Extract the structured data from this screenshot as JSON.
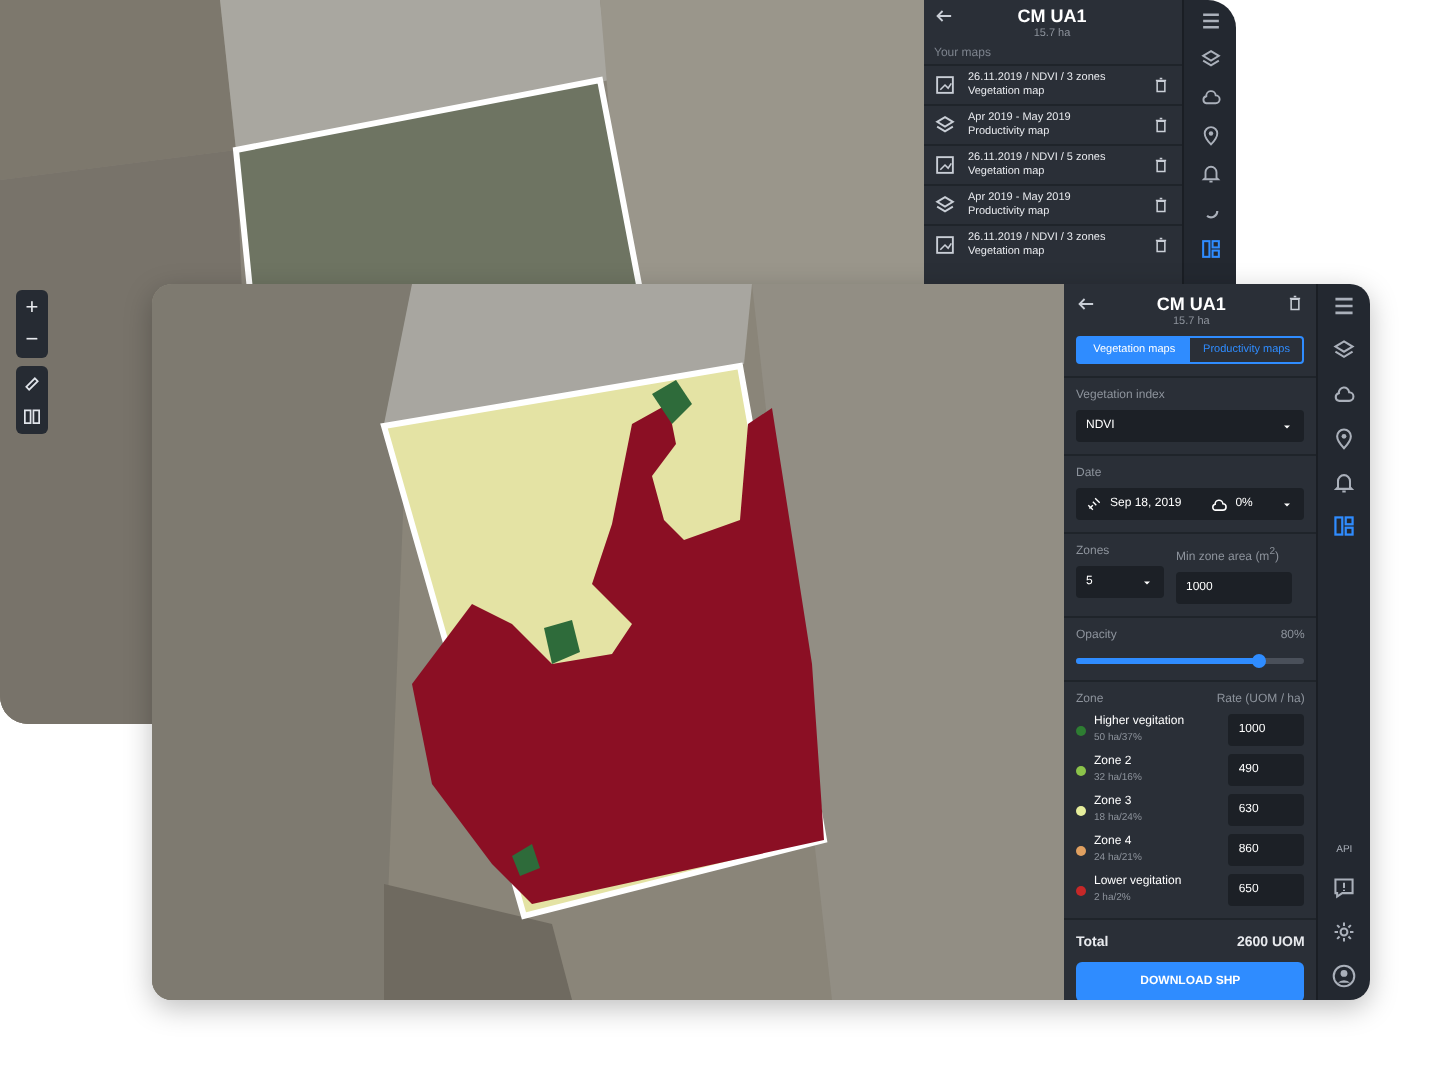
{
  "back_window": {
    "title": "CM UA1",
    "area": "15.7 ha",
    "section_label": "Your maps",
    "maps": [
      {
        "kind": "vegetation",
        "title": "26.11.2019 / NDVI / 3 zones",
        "subtitle": "Vegetation map"
      },
      {
        "kind": "productivity",
        "title": "Apr 2019 - May 2019",
        "subtitle": "Productivity map"
      },
      {
        "kind": "vegetation",
        "title": "26.11.2019 / NDVI / 5 zones",
        "subtitle": "Vegetation map"
      },
      {
        "kind": "productivity",
        "title": "Apr 2019 - May 2019",
        "subtitle": "Productivity map"
      },
      {
        "kind": "vegetation",
        "title": "26.11.2019 / NDVI / 3 zones",
        "subtitle": "Vegetation map"
      }
    ],
    "rail": [
      {
        "kind": "menu",
        "selected": false
      },
      {
        "kind": "layers",
        "selected": false
      },
      {
        "kind": "cloud",
        "selected": false
      },
      {
        "kind": "pin",
        "selected": false
      },
      {
        "kind": "bell",
        "selected": false
      },
      {
        "kind": "spinner",
        "selected": false
      },
      {
        "kind": "grid",
        "selected": true
      }
    ],
    "map_controls": {
      "zoom_in": "+",
      "zoom_out": "−"
    }
  },
  "front_window": {
    "title": "CM UA1",
    "area": "15.7 ha",
    "tabs": [
      {
        "label": "Vegetation maps",
        "selected": true
      },
      {
        "label": "Productivity maps",
        "selected": false
      }
    ],
    "vegetation_index": {
      "label": "Vegetation index",
      "value": "NDVI"
    },
    "date": {
      "label": "Date",
      "value": "Sep 18, 2019",
      "cloud_cover": "0%"
    },
    "zones": {
      "label": "Zones",
      "value": "5"
    },
    "min_zone_area": {
      "label": "Min zone area (m$^{2}$)",
      "value": "1000"
    },
    "opacity": {
      "label": "Opacity",
      "reading": "80%",
      "level": 0.8
    },
    "zone_table": {
      "columns": [
        "Zone",
        "Rate (UOM / ha)"
      ],
      "rows": [
        {
          "name": "Higher vegitation",
          "area": "50 ha/37%",
          "rate": "1000",
          "color": "#2e7d32"
        },
        {
          "name": "Zone 2",
          "area": "32 ha/16%",
          "rate": "490",
          "color": "#8bc34a"
        },
        {
          "name": "Zone 3",
          "area": "18 ha/24%",
          "rate": "630",
          "color": "#e6ee9c"
        },
        {
          "name": "Zone 4",
          "area": "24 ha/21%",
          "rate": "860",
          "color": "#e0a060"
        },
        {
          "name": "Lower vegitation",
          "area": "2 ha/2%",
          "rate": "650",
          "color": "#c62828"
        }
      ]
    },
    "total": {
      "label": "Total",
      "value": "2600 UOM"
    },
    "download_button": "DOWNLOAD SHP",
    "rail": [
      {
        "kind": "menu",
        "selected": false
      },
      {
        "kind": "layers",
        "selected": false
      },
      {
        "kind": "cloud",
        "selected": false
      },
      {
        "kind": "pin",
        "selected": false
      },
      {
        "kind": "bell",
        "selected": false
      },
      {
        "kind": "grid",
        "selected": true
      }
    ],
    "rail_bottom": {
      "api_label": "API",
      "items": [
        {
          "kind": "chat"
        },
        {
          "kind": "gear"
        },
        {
          "kind": "user"
        }
      ]
    }
  }
}
